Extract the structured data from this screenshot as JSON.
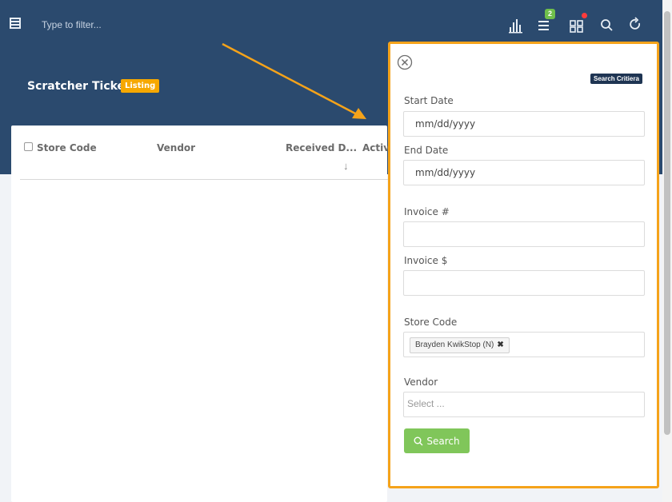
{
  "topbar": {
    "filter_placeholder": "Type to filter...",
    "notification_count": "2",
    "icons": [
      "menu-icon",
      "bar-chart-icon",
      "list-icon",
      "grid-icon",
      "search-icon",
      "refresh-icon"
    ]
  },
  "page": {
    "title": "Scratcher Ticket",
    "badge": "Listing"
  },
  "table": {
    "columns": [
      "Store Code",
      "Vendor",
      "Received D...",
      "Activ"
    ],
    "sort_indicator": "↓"
  },
  "panel": {
    "badge": "Search Critiera",
    "fields": {
      "start_date_label": "Start Date",
      "start_date_placeholder": "mm/dd/yyyy",
      "end_date_label": "End Date",
      "end_date_placeholder": "mm/dd/yyyy",
      "invoice_no_label": "Invoice #",
      "invoice_amt_label": "Invoice $",
      "store_code_label": "Store Code",
      "store_code_tag": "Brayden KwikStop (N)",
      "tag_remove": "✖",
      "vendor_label": "Vendor",
      "vendor_placeholder": "Select ..."
    },
    "search_button": "Search"
  },
  "colors": {
    "header": "#2b4a6e",
    "accent_orange": "#f5a31a",
    "listing_badge": "#f6a800",
    "search_green": "#80c65a",
    "badge_green": "#6fbf4b"
  }
}
